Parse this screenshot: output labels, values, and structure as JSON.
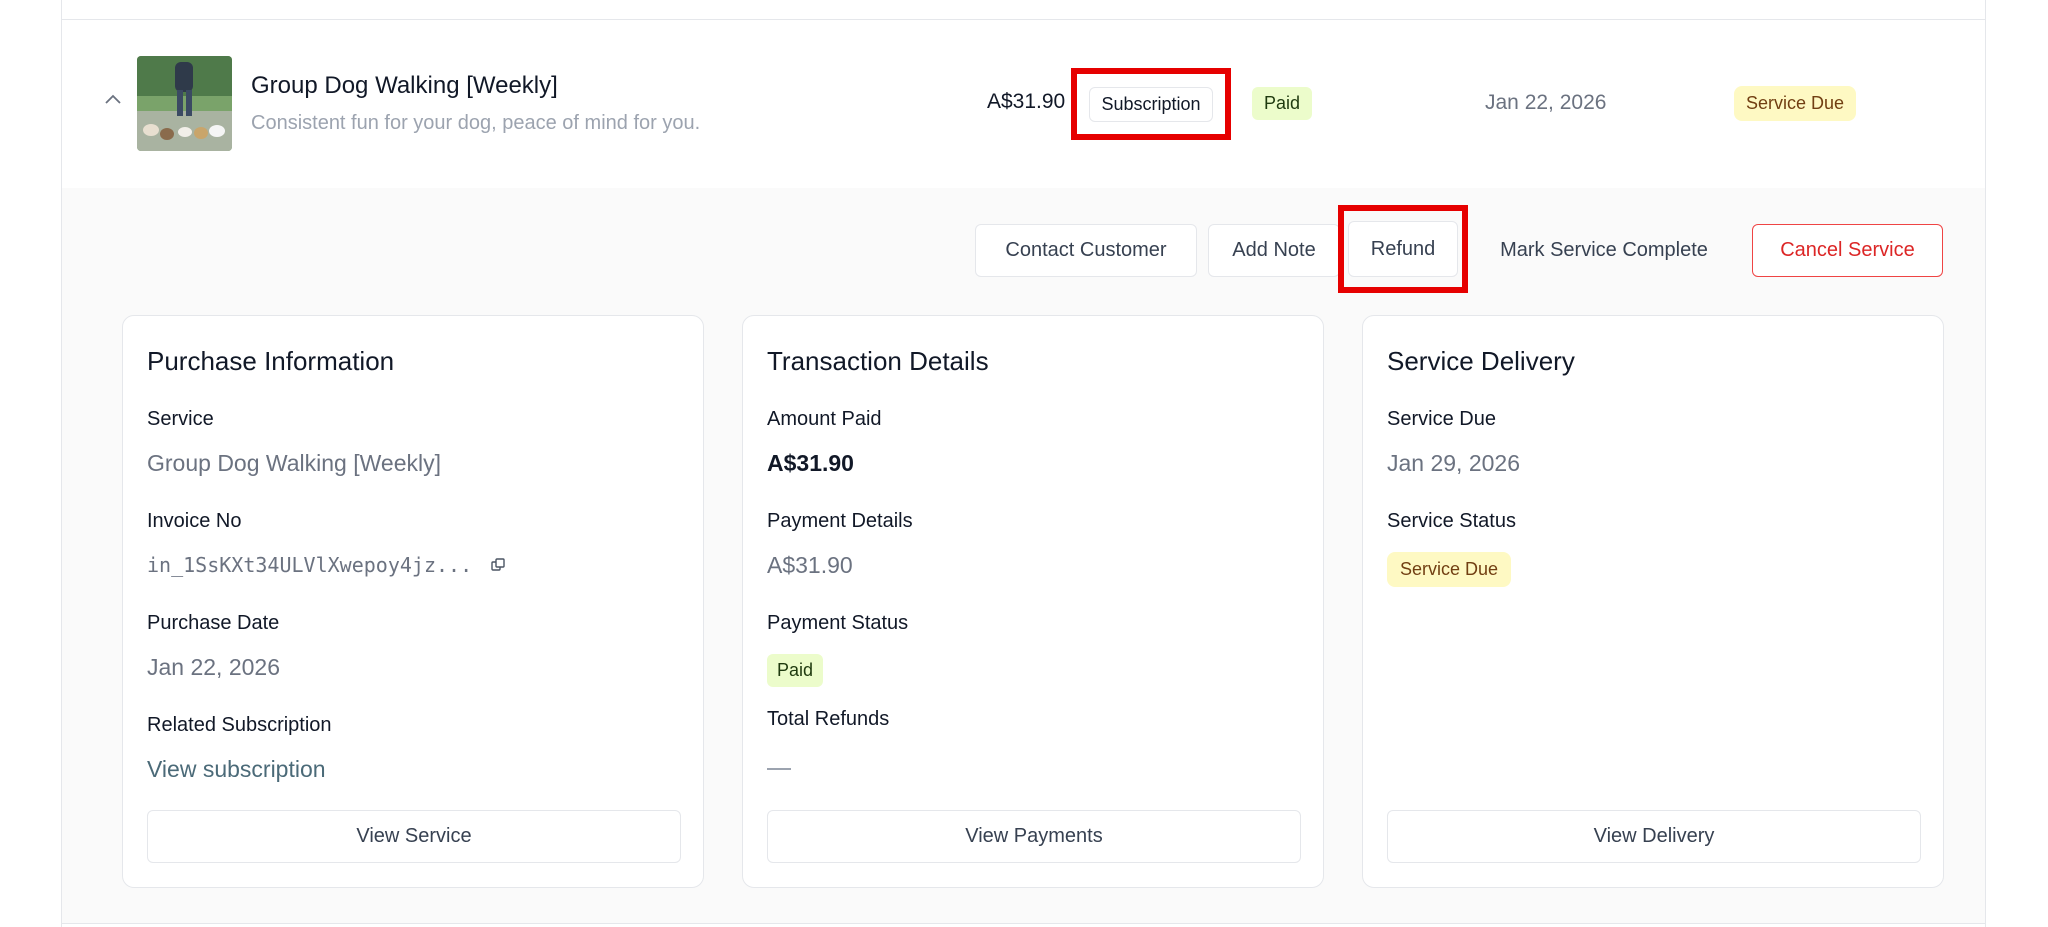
{
  "row": {
    "title": "Group Dog Walking [Weekly]",
    "subtitle": "Consistent fun for your dog, peace of mind for you.",
    "price": "A$31.90",
    "type_badge": "Subscription",
    "payment_badge": "Paid",
    "date": "Jan 22, 2026",
    "status_badge": "Service Due",
    "icons": {
      "expand": "chevron-up-icon",
      "thumbnail": "dog-walking-photo"
    }
  },
  "actions": {
    "contact": "Contact Customer",
    "note": "Add Note",
    "refund": "Refund",
    "complete": "Mark Service Complete",
    "cancel": "Cancel Service"
  },
  "purchase": {
    "title": "Purchase Information",
    "service_label": "Service",
    "service_value": "Group Dog Walking [Weekly]",
    "invoice_label": "Invoice No",
    "invoice_value": "in_1SsKXt34ULVlXwepoy4jz...",
    "date_label": "Purchase Date",
    "date_value": "Jan 22, 2026",
    "related_label": "Related Subscription",
    "related_link": "View subscription",
    "button": "View Service"
  },
  "transaction": {
    "title": "Transaction Details",
    "amount_label": "Amount Paid",
    "amount_value": "A$31.90",
    "details_label": "Payment Details",
    "details_value": "A$31.90",
    "status_label": "Payment Status",
    "status_value": "Paid",
    "refunds_label": "Total Refunds",
    "button": "View Payments"
  },
  "delivery": {
    "title": "Service Delivery",
    "due_label": "Service Due",
    "due_value": "Jan 29, 2026",
    "status_label": "Service Status",
    "status_value": "Service Due",
    "button": "View Delivery"
  },
  "colors": {
    "highlight": "#e60000",
    "paid_bg": "#ecfccb",
    "due_bg": "#fef9c3",
    "cancel": "#dc2626"
  }
}
